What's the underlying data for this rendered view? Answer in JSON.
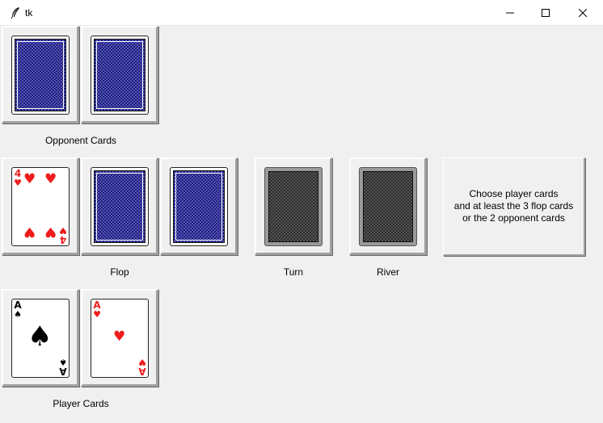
{
  "window": {
    "title": "tk",
    "controls": {
      "minimize": "minimize-icon",
      "maximize": "maximize-icon",
      "close": "close-icon"
    }
  },
  "opponent": {
    "label": "Opponent Cards",
    "cards": [
      {
        "state": "face-down",
        "back": "blue"
      },
      {
        "state": "face-down",
        "back": "blue"
      }
    ]
  },
  "board": {
    "flop": {
      "label": "Flop",
      "cards": [
        {
          "state": "face-up",
          "rank": "4",
          "suit": "♥",
          "color": "#ee1c1c"
        },
        {
          "state": "face-down",
          "back": "blue"
        },
        {
          "state": "face-down",
          "back": "blue"
        }
      ]
    },
    "turn": {
      "label": "Turn",
      "card": {
        "state": "face-down",
        "back": "grey"
      }
    },
    "river": {
      "label": "River",
      "card": {
        "state": "face-down",
        "back": "grey"
      }
    }
  },
  "message": {
    "text": "Choose player cards\nand at least the 3 flop cards\nor the 2 opponent cards"
  },
  "player": {
    "label": "Player Cards",
    "cards": [
      {
        "state": "face-up",
        "rank": "A",
        "suit": "♠",
        "color": "#000000"
      },
      {
        "state": "face-up",
        "rank": "A",
        "suit": "♥",
        "color": "#ee1c1c"
      }
    ]
  }
}
